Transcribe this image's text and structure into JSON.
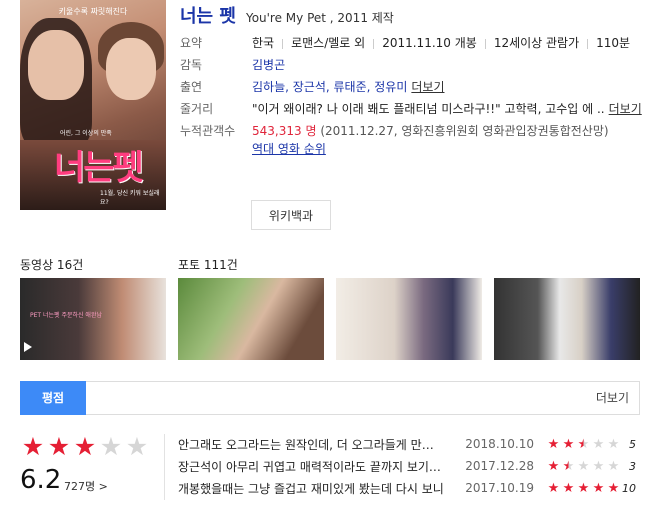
{
  "movie": {
    "title": "너는 펫",
    "subtitle": "You're My Pet , 2011 제작",
    "poster_header": "키울수록 짜릿해진다",
    "poster_title": "너는펫",
    "poster_kicker": "어린, 그 이상의 만족",
    "poster_date": "11월, 당신 키워 보실래요?"
  },
  "info": {
    "summary_label": "요약",
    "summary": [
      "한국",
      "로맨스/멜로 외",
      "2011.11.10 개봉",
      "12세이상 관람가",
      "110분"
    ],
    "director_label": "감독",
    "director": "김병곤",
    "cast_label": "출연",
    "cast": "김하늘, 장근석, 류태준, 정유미",
    "more": "더보기",
    "plot_label": "줄거리",
    "plot": "\"이거 왜이래? 나 이래 봬도 플래티넘 미스라구!!\" 고학력, 고수입 에 ..",
    "audience_label": "누적관객수",
    "audience_count": "543,313 명",
    "audience_source": "(2011.12.27, 영화진흥위원회 영화관입장권통합전산망)",
    "ranking_link": "역대 영화 순위",
    "wiki_button": "위키백과"
  },
  "media": {
    "video_label": "동영상 16건",
    "photo_label": "포토 111건",
    "video_thumb_text": "PET 너는펫 주문하신 애완남"
  },
  "rating_tab": {
    "tab_label": "평점",
    "more": "더보기"
  },
  "rating": {
    "score": "6.2",
    "count": "727명 >",
    "stars_filled": 3,
    "stars_total": 5
  },
  "reviews": [
    {
      "text": "안그래도 오그라드는 원작인데, 더 오그라들게 만들어 버렸네",
      "date": "2018.10.10",
      "score": "5",
      "stars": 2.5
    },
    {
      "text": "장근석이 아무리 귀엽고 매력적이라도 끝까지 보기 힘들다",
      "date": "2017.12.28",
      "score": "3",
      "stars": 1.5
    },
    {
      "text": "개봉했을때는 그냥 즐겁고 재미있게 봤는데 다시 보니",
      "date": "2017.10.19",
      "score": "10",
      "stars": 5
    }
  ]
}
